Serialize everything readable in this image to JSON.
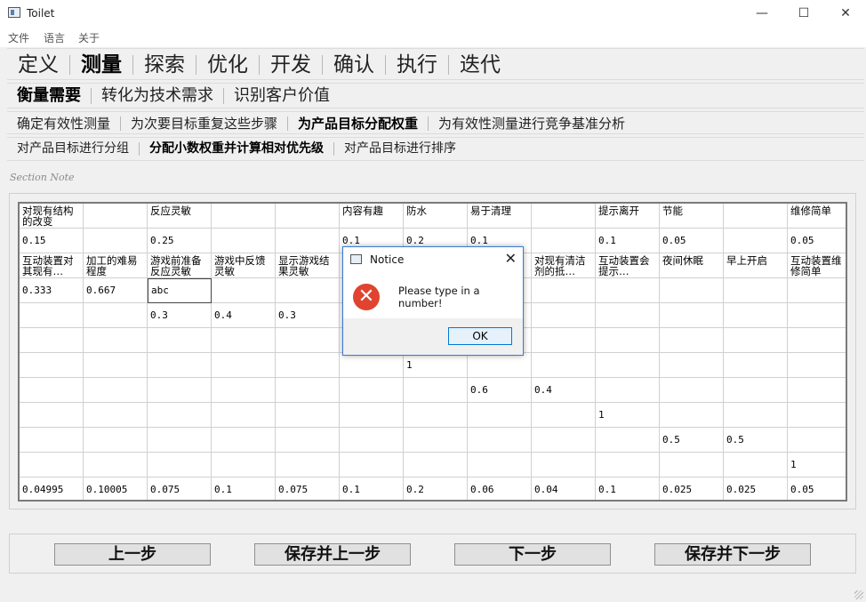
{
  "window": {
    "title": "Toilet",
    "min_glyph": "—",
    "max_glyph": "☐",
    "close_glyph": "✕"
  },
  "menu": [
    "文件",
    "语言",
    "关于"
  ],
  "nav1": {
    "items": [
      "定义",
      "测量",
      "探索",
      "优化",
      "开发",
      "确认",
      "执行",
      "迭代"
    ],
    "active": 1
  },
  "nav2": {
    "items": [
      "衡量需要",
      "转化为技术需求",
      "识别客户价值"
    ],
    "active": 0
  },
  "nav3": {
    "items": [
      "确定有效性测量",
      "为次要目标重复这些步骤",
      "为产品目标分配权重",
      "为有效性测量进行竞争基准分析"
    ],
    "active": 2
  },
  "nav4": {
    "items": [
      "对产品目标进行分组",
      "分配小数权重并计算相对优先级",
      "对产品目标进行排序"
    ],
    "active": 1
  },
  "section_note": "Section Note",
  "table": {
    "rows": [
      [
        "对现有结构的改变",
        "",
        "反应灵敏",
        "",
        "",
        "内容有趣",
        "防水",
        "易于清理",
        "",
        "提示离开",
        "节能",
        "",
        "维修简单"
      ],
      [
        "0.15",
        "",
        "0.25",
        "",
        "",
        "0.1",
        "0.2",
        "0.1",
        "",
        "0.1",
        "0.05",
        "",
        "0.05"
      ],
      [
        "互动装置对其现有…",
        "加工的难易程度",
        "游戏前准备反应灵敏",
        "游戏中反馈灵敏",
        "显示游戏结果灵敏",
        "",
        "",
        "",
        "对现有清洁剂的抵…",
        "互动装置会提示…",
        "夜间休眠",
        "早上开启",
        "互动装置维修简单"
      ],
      [
        "0.333",
        "0.667",
        "abc",
        "",
        "",
        "",
        "",
        "",
        "",
        "",
        "",
        "",
        ""
      ],
      [
        "",
        "",
        "0.3",
        "0.4",
        "0.3",
        "",
        "",
        "",
        "",
        "",
        "",
        "",
        ""
      ],
      [
        "",
        "",
        "",
        "",
        "",
        "",
        "",
        "",
        "",
        "",
        "",
        "",
        ""
      ],
      [
        "",
        "",
        "",
        "",
        "",
        "",
        "1",
        "",
        "",
        "",
        "",
        "",
        ""
      ],
      [
        "",
        "",
        "",
        "",
        "",
        "",
        "",
        "0.6",
        "0.4",
        "",
        "",
        "",
        ""
      ],
      [
        "",
        "",
        "",
        "",
        "",
        "",
        "",
        "",
        "",
        "1",
        "",
        "",
        ""
      ],
      [
        "",
        "",
        "",
        "",
        "",
        "",
        "",
        "",
        "",
        "",
        "0.5",
        "0.5",
        ""
      ],
      [
        "",
        "",
        "",
        "",
        "",
        "",
        "",
        "",
        "",
        "",
        "",
        "",
        "1"
      ],
      [
        "0.04995",
        "0.10005",
        "0.075",
        "0.1",
        "0.075",
        "0.1",
        "0.2",
        "0.06",
        "0.04",
        "0.1",
        "0.025",
        "0.025",
        "0.05"
      ]
    ],
    "editing_cell": [
      3,
      2
    ]
  },
  "buttons": {
    "prev": "上一步",
    "save_prev": "保存并上一步",
    "next": "下一步",
    "save_next": "保存并下一步"
  },
  "dialog": {
    "title": "Notice",
    "message": "Please type in a number!",
    "ok": "OK",
    "icon": "error-icon",
    "close_glyph": "✕",
    "icon_glyph": "✕"
  }
}
